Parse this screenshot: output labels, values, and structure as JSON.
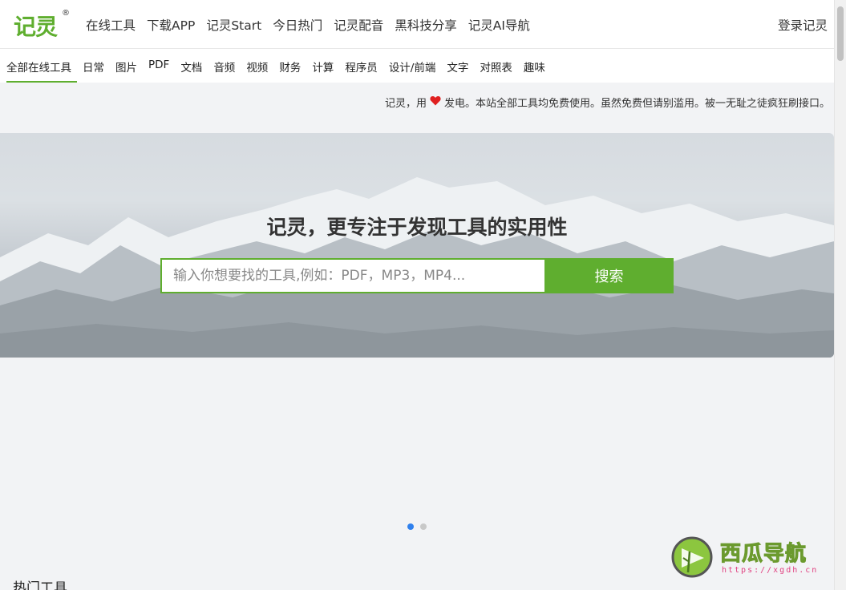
{
  "brand": {
    "logo": "记灵",
    "reg": "®"
  },
  "topnav": [
    "在线工具",
    "下载APP",
    "记灵Start",
    "今日热门",
    "记灵配音",
    "黑科技分享",
    "记灵AI导航"
  ],
  "login": "登录记灵",
  "categories": [
    "全部在线工具",
    "日常",
    "图片",
    "PDF",
    "文档",
    "音频",
    "视频",
    "财务",
    "计算",
    "程序员",
    "设计/前端",
    "文字",
    "对照表",
    "趣味"
  ],
  "active_category": "全部在线工具",
  "notice": {
    "before": "记灵，用",
    "icon": "heart-icon",
    "after": "发电。本站全部工具均免费使用。虽然免费但请别滥用。被一无耻之徒疯狂刷接口。"
  },
  "hero": {
    "title": "记灵，更专注于发现工具的实用性",
    "placeholder": "输入你想要找的工具,例如：PDF，MP3，MP4...",
    "search_label": "搜索"
  },
  "carousel": {
    "slides": 2,
    "active": 1
  },
  "section_title": "热门工具",
  "watermark": {
    "name": "西瓜导航",
    "url": "https://xgdh.cn"
  },
  "colors": {
    "accent": "#5fae2f",
    "dot_active": "#2f80ed",
    "heart": "#e02020"
  }
}
